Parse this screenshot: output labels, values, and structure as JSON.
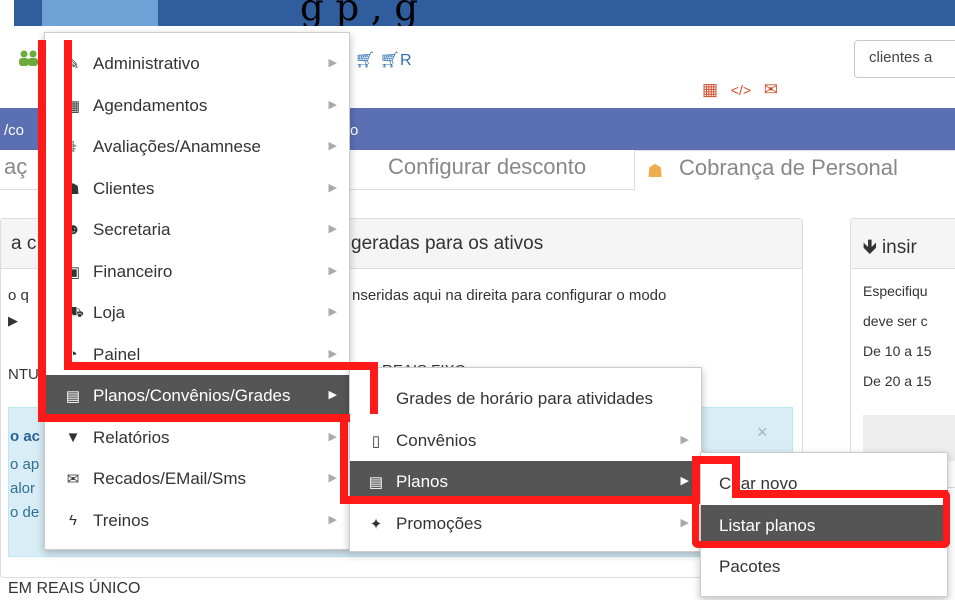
{
  "header": {
    "title_fragment": "g   p    ,         g"
  },
  "nav": {
    "cart_labels": [
      "O",
      "",
      "R"
    ],
    "search_value": "clientes a"
  },
  "breadcrumb": {
    "left": "/co",
    "right": "o"
  },
  "tabs": [
    {
      "label": "aç"
    },
    {
      "label": "Configurar desconto"
    },
    {
      "label": "Cobrança de Personal"
    }
  ],
  "panels": {
    "left_head": "a c",
    "center_head": "geradas para os ativos",
    "center_text": "nseridas aqui na direita para configurar o modo",
    "left_text1": "o q",
    "left_text2": "NTU",
    "fixed_label": "REAIS FIXO",
    "alert_lines": [
      "o ac",
      "o ap",
      "alor",
      "o de"
    ],
    "bottom_label": "EM REAIS ÚNICO",
    "right_head": "insir",
    "right_lines": [
      "Especifiqu",
      "deve ser c",
      "De 10 a 15",
      "De 20 a 15"
    ]
  },
  "main_menu": [
    {
      "label": "Administrativo",
      "icon": "wrench-icon",
      "glyph": "✎"
    },
    {
      "label": "Agendamentos",
      "icon": "calendar-icon",
      "glyph": "▦"
    },
    {
      "label": "Avaliações/Anamnese",
      "icon": "stethoscope-icon",
      "glyph": "⚕"
    },
    {
      "label": "Clientes",
      "icon": "users-icon",
      "glyph": "☗"
    },
    {
      "label": "Secretaria",
      "icon": "user-tie-icon",
      "glyph": "☻"
    },
    {
      "label": "Financeiro",
      "icon": "money-icon",
      "glyph": "▣"
    },
    {
      "label": "Loja",
      "icon": "cart-icon",
      "glyph": "⛟"
    },
    {
      "label": "Painel",
      "icon": "dashboard-icon",
      "glyph": "◔"
    },
    {
      "label": "Planos/Convênios/Grades",
      "icon": "file-icon",
      "glyph": "▤"
    },
    {
      "label": "Relatórios",
      "icon": "filter-icon",
      "glyph": "▼"
    },
    {
      "label": "Recados/EMail/Sms",
      "icon": "envelope-icon",
      "glyph": "✉"
    },
    {
      "label": "Treinos",
      "icon": "bolt-icon",
      "glyph": "ϟ"
    }
  ],
  "sub_menu": [
    {
      "label": "Grades de horário para atividades",
      "icon": "",
      "glyph": ""
    },
    {
      "label": "Convênios",
      "icon": "phone-icon",
      "glyph": "▯"
    },
    {
      "label": "Planos",
      "icon": "file-icon",
      "glyph": "▤"
    },
    {
      "label": "Promoções",
      "icon": "gift-icon",
      "glyph": "✦"
    }
  ],
  "sub_sub_menu": [
    {
      "label": "Criar novo"
    },
    {
      "label": "Listar planos"
    },
    {
      "label": "Pacotes"
    }
  ],
  "colors": {
    "top_bar": "#2f5d9d",
    "crumb_bar": "#5b6fb3",
    "menu_dark": "#555555",
    "annotation_red": "#ff1a1a"
  }
}
